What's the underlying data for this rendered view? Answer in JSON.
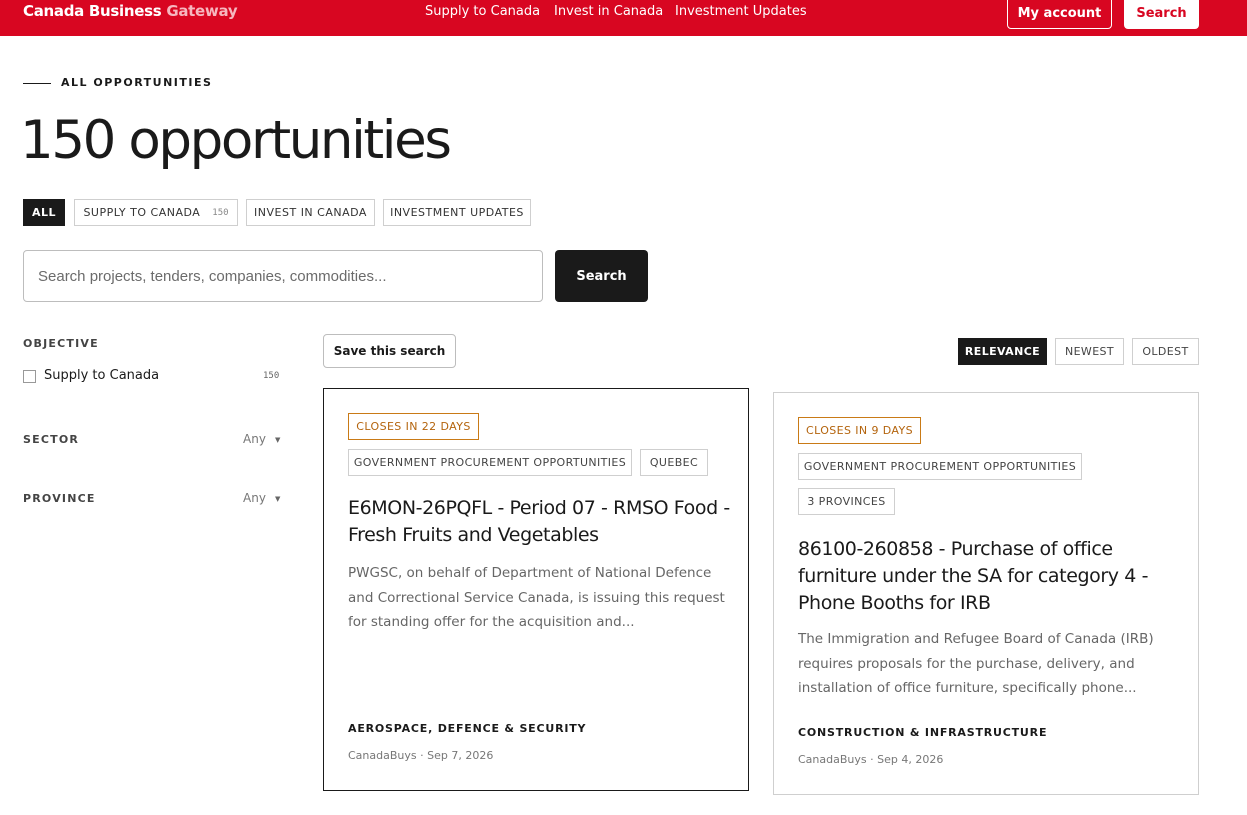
{
  "header": {
    "brand_main": "Canada Business",
    "brand_accent": "Gateway",
    "nav": [
      "Supply to Canada",
      "Invest in Canada",
      "Investment Updates"
    ],
    "account_label": "My account",
    "search_label": "Search",
    "colors": {
      "brand_red": "#d80621",
      "brand_accent": "#f6b7bf"
    }
  },
  "page": {
    "eyebrow": "ALL OPPORTUNITIES",
    "title": "150 opportunities"
  },
  "tabs": [
    {
      "label": "ALL",
      "active": true
    },
    {
      "label": "SUPPLY TO CANADA",
      "count": "150"
    },
    {
      "label": "INVEST IN CANADA"
    },
    {
      "label": "INVESTMENT UPDATES"
    }
  ],
  "search": {
    "placeholder": "Search projects, tenders, companies, commodities...",
    "button_label": "Search"
  },
  "filters": {
    "objective": {
      "title": "OBJECTIVE",
      "option_label": "Supply to Canada",
      "option_count": "150",
      "icon": "checkbox-icon"
    },
    "sector": {
      "title": "SECTOR",
      "value": "Any",
      "icon": "caret-down-icon"
    },
    "province": {
      "title": "PROVINCE",
      "value": "Any",
      "icon": "caret-down-icon"
    }
  },
  "toolbar": {
    "save_label": "Save this search",
    "sort": [
      {
        "label": "RELEVANCE",
        "active": true
      },
      {
        "label": "NEWEST"
      },
      {
        "label": "OLDEST"
      }
    ]
  },
  "cards": [
    {
      "closes": "CLOSES IN 22 DAYS",
      "chips": [
        "GOVERNMENT PROCUREMENT OPPORTUNITIES",
        "QUEBEC"
      ],
      "title": "E6MON-26PQFL - Period 07 - RMSO Food - Fresh Fruits and Vegetables",
      "description": "PWGSC, on behalf of Department of National Defence and Correctional Service Canada, is issuing this request for standing offer for the acquisition and...",
      "sector": "AEROSPACE, DEFENCE & SECURITY",
      "meta": "CanadaBuys · Sep 7, 2026"
    },
    {
      "closes": "CLOSES IN 9 DAYS",
      "chips": [
        "GOVERNMENT PROCUREMENT OPPORTUNITIES",
        "3 PROVINCES"
      ],
      "title": "86100-260858 - Purchase of office furniture under the SA for category 4 - Phone Booths for IRB",
      "description": "The Immigration and Refugee Board of Canada (IRB) requires proposals for the purchase, delivery, and installation of office furniture, specifically phone...",
      "sector": "CONSTRUCTION & INFRASTRUCTURE",
      "meta": "CanadaBuys · Sep 4, 2026"
    }
  ]
}
